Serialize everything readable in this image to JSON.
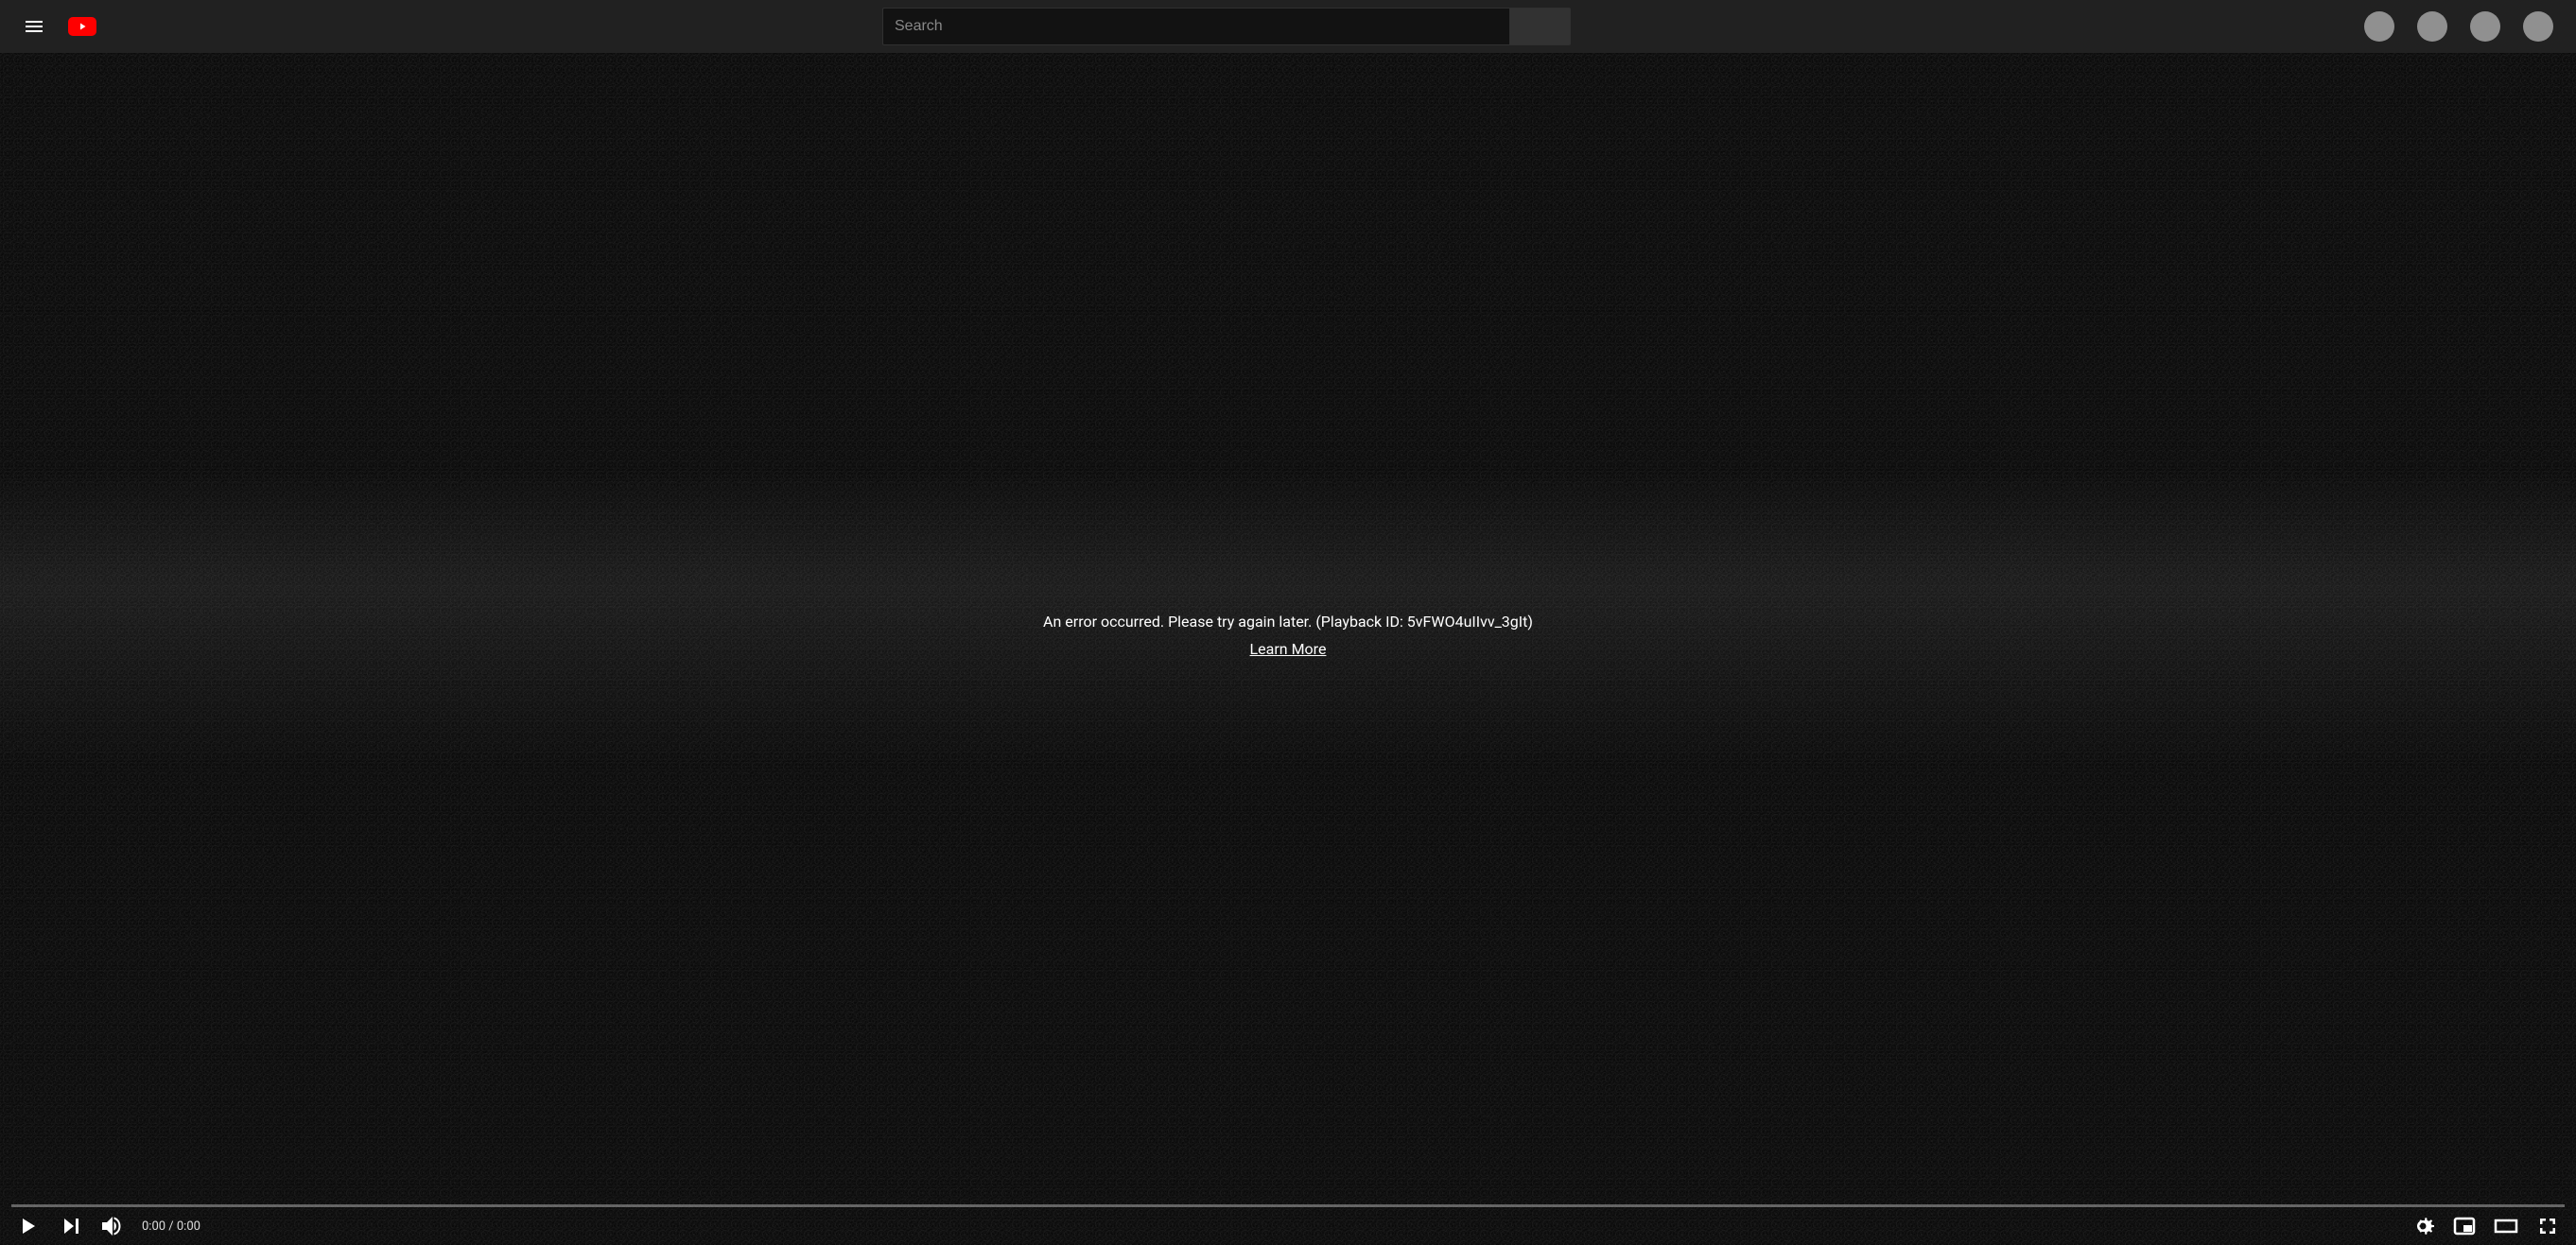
{
  "header": {
    "search_placeholder": "Search"
  },
  "player": {
    "error_message": "An error occurred. Please try again later. (Playback ID: 5vFWO4uIIvv_3gIt)",
    "learn_more_label": "Learn More",
    "time_display": "0:00 / 0:00"
  }
}
